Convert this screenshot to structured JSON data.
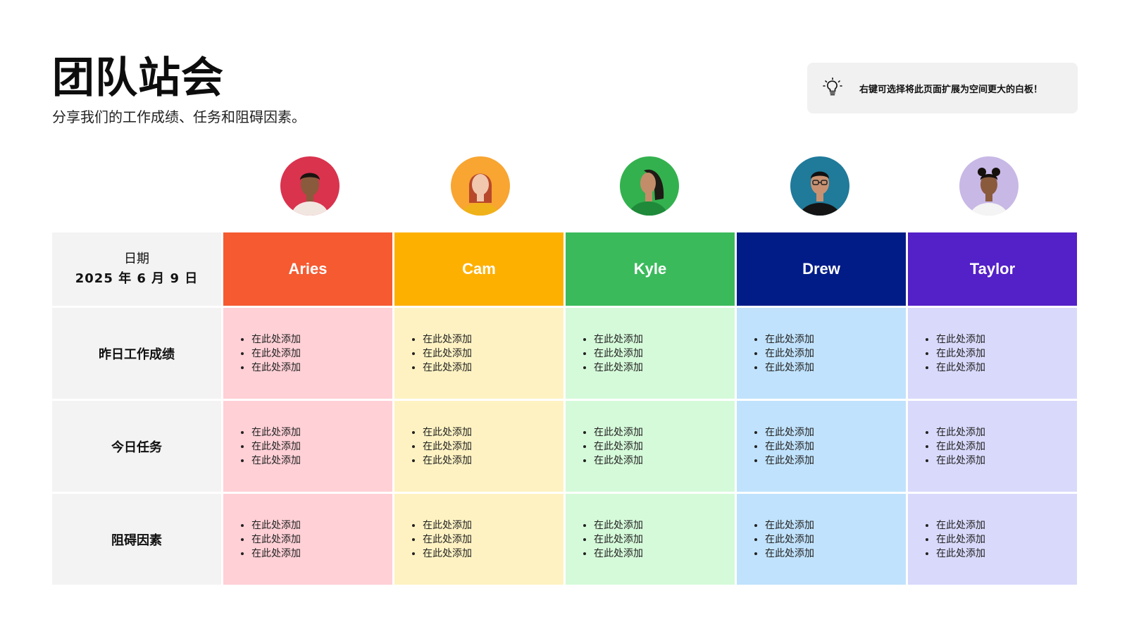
{
  "page": {
    "title": "团队站会",
    "subtitle": "分享我们的工作成绩、任务和阻碍因素。"
  },
  "tip": {
    "icon": "lightbulb-icon",
    "text": "右键可选择将此页面扩展为空间更大的白板！"
  },
  "table": {
    "date_label": "日期",
    "date_value": "2025 年 6 月 9 日",
    "rows": [
      "昨日工作成绩",
      "今日任务",
      "阻碍因素"
    ],
    "placeholder_item": "在此处添加",
    "members": [
      {
        "name": "Aries",
        "header_color": "#f55a31",
        "cell_color": "#ffd0d6",
        "avatar_bg": "#d9334e"
      },
      {
        "name": "Cam",
        "header_color": "#feb000",
        "cell_color": "#fef2c2",
        "avatar_bg": "#f8a531"
      },
      {
        "name": "Kyle",
        "header_color": "#3bba5c",
        "cell_color": "#d5fad9",
        "avatar_bg": "#33b14e"
      },
      {
        "name": "Drew",
        "header_color": "#011c87",
        "cell_color": "#c0e2fc",
        "avatar_bg": "#207a9a"
      },
      {
        "name": "Taylor",
        "header_color": "#5420c7",
        "cell_color": "#d9d9fc",
        "avatar_bg": "#c8b8e6"
      }
    ]
  }
}
